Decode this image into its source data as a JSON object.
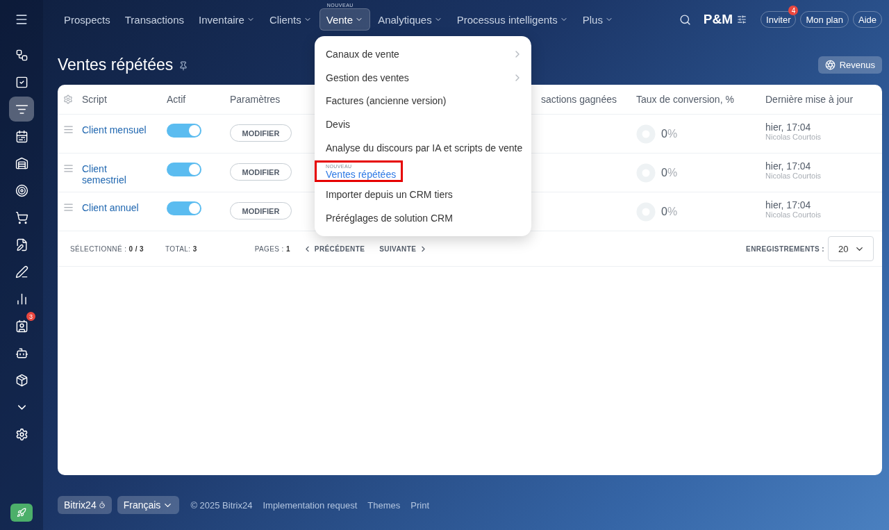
{
  "sidebar": {
    "items": [
      {
        "selected": false
      },
      {
        "selected": false
      },
      {
        "selected": true
      },
      {
        "selected": false
      },
      {
        "selected": false
      },
      {
        "selected": false
      },
      {
        "selected": false
      },
      {
        "selected": false
      },
      {
        "selected": false
      },
      {
        "selected": false
      },
      {
        "selected": false,
        "badge": "3"
      },
      {
        "selected": false
      },
      {
        "selected": false
      },
      {
        "selected": false
      }
    ]
  },
  "topnav": {
    "items": [
      {
        "label": "Prospects",
        "dropdown": false,
        "selected": false
      },
      {
        "label": "Transactions",
        "dropdown": false,
        "selected": false
      },
      {
        "label": "Inventaire",
        "dropdown": true,
        "selected": false
      },
      {
        "label": "Clients",
        "dropdown": true,
        "selected": false
      },
      {
        "label": "Vente",
        "dropdown": true,
        "selected": true,
        "tag": "NOUVEAU"
      },
      {
        "label": "Analytiques",
        "dropdown": true,
        "selected": false
      },
      {
        "label": "Processus intelligents",
        "dropdown": true,
        "selected": false
      },
      {
        "label": "Plus",
        "dropdown": true,
        "selected": false
      }
    ],
    "brand": "P&M",
    "buttons": [
      {
        "label": "Inviter",
        "badge": "4"
      },
      {
        "label": "Mon plan"
      },
      {
        "label": "Aide"
      }
    ]
  },
  "page": {
    "title": "Ventes répétées",
    "action": "Revenus"
  },
  "menu": {
    "items": [
      {
        "label": "Canaux de vente",
        "submenu": true,
        "highlighted": false
      },
      {
        "label": "Gestion des ventes",
        "submenu": true,
        "highlighted": false
      },
      {
        "label": "Factures (ancienne version)",
        "submenu": false,
        "highlighted": false
      },
      {
        "label": "Devis",
        "submenu": false,
        "highlighted": false
      },
      {
        "label": "Analyse du discours par IA et scripts de vente",
        "submenu": false,
        "highlighted": false
      },
      {
        "label": "Ventes répétées",
        "submenu": false,
        "highlighted": true,
        "tag": "NOUVEAU"
      },
      {
        "label": "Importer depuis un CRM tiers",
        "submenu": false,
        "highlighted": false
      },
      {
        "label": "Préréglages de solution CRM",
        "submenu": false,
        "highlighted": false
      }
    ]
  },
  "table": {
    "columns": [
      "Script",
      "Actif",
      "Paramètres",
      "sactions gagnées",
      "Taux de conversion, %",
      "Dernière mise à jour"
    ],
    "rows": [
      {
        "name": "Client mensuel",
        "active": true,
        "button": "MODIFIER",
        "rate_value": "0",
        "rate_unit": "%",
        "updated": "hier, 17:04",
        "updated_by": "Nicolas Courtois"
      },
      {
        "name": "Client semestriel",
        "active": true,
        "button": "MODIFIER",
        "rate_value": "0",
        "rate_unit": "%",
        "updated": "hier, 17:04",
        "updated_by": "Nicolas Courtois"
      },
      {
        "name": "Client annuel",
        "active": true,
        "button": "MODIFIER",
        "rate_value": "0",
        "rate_unit": "%",
        "updated": "hier, 17:04",
        "updated_by": "Nicolas Courtois"
      }
    ],
    "pagination": {
      "selected": "SÉLECTIONNÉ : **0 / 3**",
      "total": "TOTAL: **3**",
      "pages": "PAGES : **1**",
      "prev": "PRÉCÉDENTE",
      "next": "SUIVANTE",
      "records_label": "ENREGISTREMENTS :",
      "records_value": "20"
    }
  },
  "footer": {
    "brand": "Bitrix24",
    "language": "Français",
    "copyright": "© 2025 Bitrix24",
    "links": [
      "Implementation request",
      "Themes",
      "Print"
    ]
  }
}
